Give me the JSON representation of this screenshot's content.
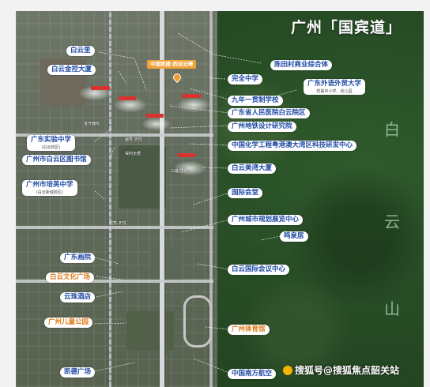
{
  "map": {
    "title": "广州「国宾道」",
    "vertical_text": [
      "白",
      "云",
      "山"
    ],
    "landmarks_left": {
      "baiyunli": "白云里",
      "baiyun_jinkong": "白云金控大厦",
      "guangdong_shiyan": {
        "name": "广东实验中学",
        "sub": "(白云校区)"
      },
      "baiyun_library": "广州市白云区图书馆",
      "peiying": {
        "name": "广州市培英中学",
        "sub": "(白云新城校区)"
      },
      "guangdong_huayuan": "广东画院",
      "baiyun_culture": "白云文化广场",
      "yunzhu_hotel": "云珠酒店",
      "children_park": "广州儿童公园",
      "kaide": "凯德广场"
    },
    "landmarks_right": {
      "chentiancun": "陈田村商业综合体",
      "wanquan": "完全中学",
      "waiyu": {
        "name": "广东外语外贸大学",
        "sub": "附属中小学、幼儿园"
      },
      "jiunian": "九年一贯制学校",
      "renmin_hospital": "广东省人民医院白云院区",
      "metro_design": "广州地铁设计研究院",
      "chem_center": "中国化学工程粤港澳大湾区科技研发中心",
      "baiyun_meiwan": "白云美湾大厦",
      "convention": "国际会堂",
      "planning_hall": "广州城市规划展览中心",
      "mingquan": "鸣泉居",
      "conference_center": "白云国际会议中心",
      "gymnasium": "广州体育馆",
      "southern_airlines": "中国南方航空"
    },
    "top_tag": "中国铁建·西派云峰",
    "small_map_texts": {
      "a": "首开鹿鸣",
      "b": "越秀·天悦",
      "c": "保利天珺",
      "d": "三盛·璞悦",
      "e": "越秀·天悦"
    }
  },
  "watermark": "搜狐号@搜狐焦点韶关站",
  "colors": {
    "label_blue": "#1f4aa3",
    "label_orange": "#e07a1a",
    "mountain_green": "#274c25",
    "tag_orange": "#f0a33a"
  }
}
